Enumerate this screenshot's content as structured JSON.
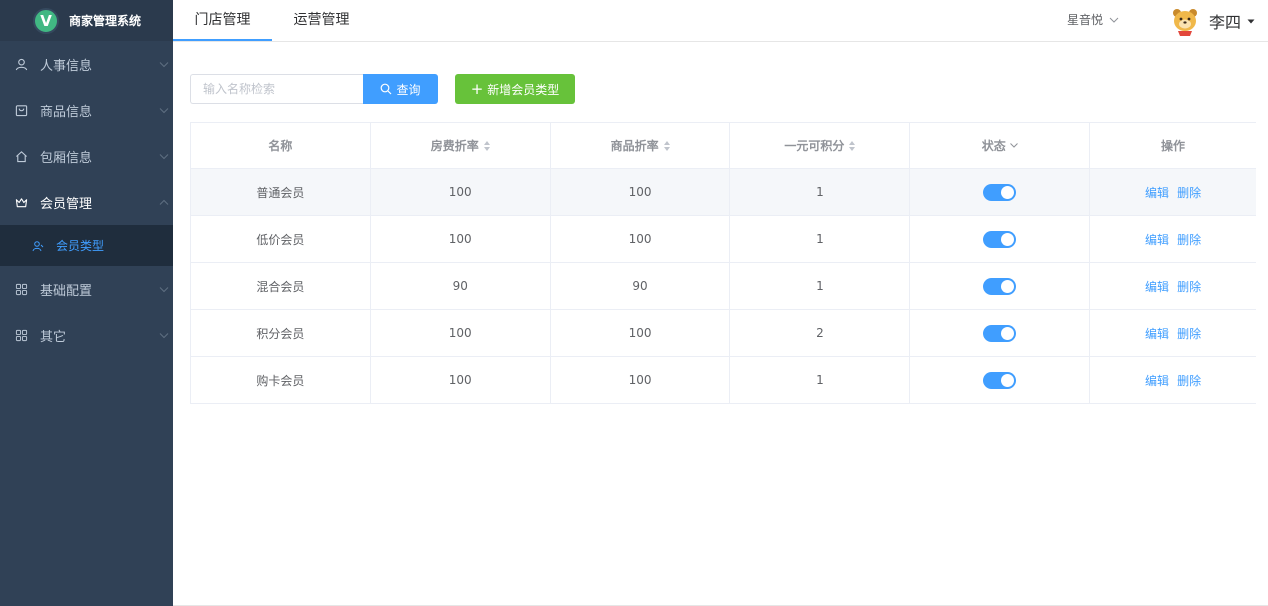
{
  "app": {
    "title": "商家管理系统",
    "logo_letter": "V"
  },
  "sidebar": {
    "items": [
      {
        "label": "人事信息",
        "icon": "user-icon",
        "expanded": false
      },
      {
        "label": "商品信息",
        "icon": "goods-icon",
        "expanded": false
      },
      {
        "label": "包厢信息",
        "icon": "home-icon",
        "expanded": false
      },
      {
        "label": "会员管理",
        "icon": "crown-icon",
        "expanded": true,
        "children": [
          {
            "label": "会员类型",
            "icon": "member-icon",
            "active": true
          }
        ]
      },
      {
        "label": "基础配置",
        "icon": "grid-icon",
        "expanded": false
      },
      {
        "label": "其它",
        "icon": "grid-icon",
        "expanded": false
      }
    ]
  },
  "header": {
    "tabs": [
      {
        "label": "门店管理",
        "active": true
      },
      {
        "label": "运营管理",
        "active": false
      }
    ],
    "shop": "星音悦",
    "user_name": "李四"
  },
  "toolbar": {
    "search_placeholder": "输入名称检索",
    "search_label": "查询",
    "add_label": "新增会员类型"
  },
  "table": {
    "columns": [
      "名称",
      "房费折率",
      "商品折率",
      "一元可积分",
      "状态",
      "操作"
    ],
    "rows": [
      {
        "name": "普通会员",
        "room_rate": "100",
        "goods_rate": "100",
        "points": "1",
        "status": true
      },
      {
        "name": "低价会员",
        "room_rate": "100",
        "goods_rate": "100",
        "points": "1",
        "status": true
      },
      {
        "name": "混合会员",
        "room_rate": "90",
        "goods_rate": "90",
        "points": "1",
        "status": true
      },
      {
        "name": "积分会员",
        "room_rate": "100",
        "goods_rate": "100",
        "points": "2",
        "status": true
      },
      {
        "name": "购卡会员",
        "room_rate": "100",
        "goods_rate": "100",
        "points": "1",
        "status": true
      }
    ],
    "actions": {
      "edit": "编辑",
      "delete": "删除"
    }
  },
  "colors": {
    "sidebar_bg": "#304156",
    "accent": "#409eff",
    "success": "#67c23a"
  }
}
